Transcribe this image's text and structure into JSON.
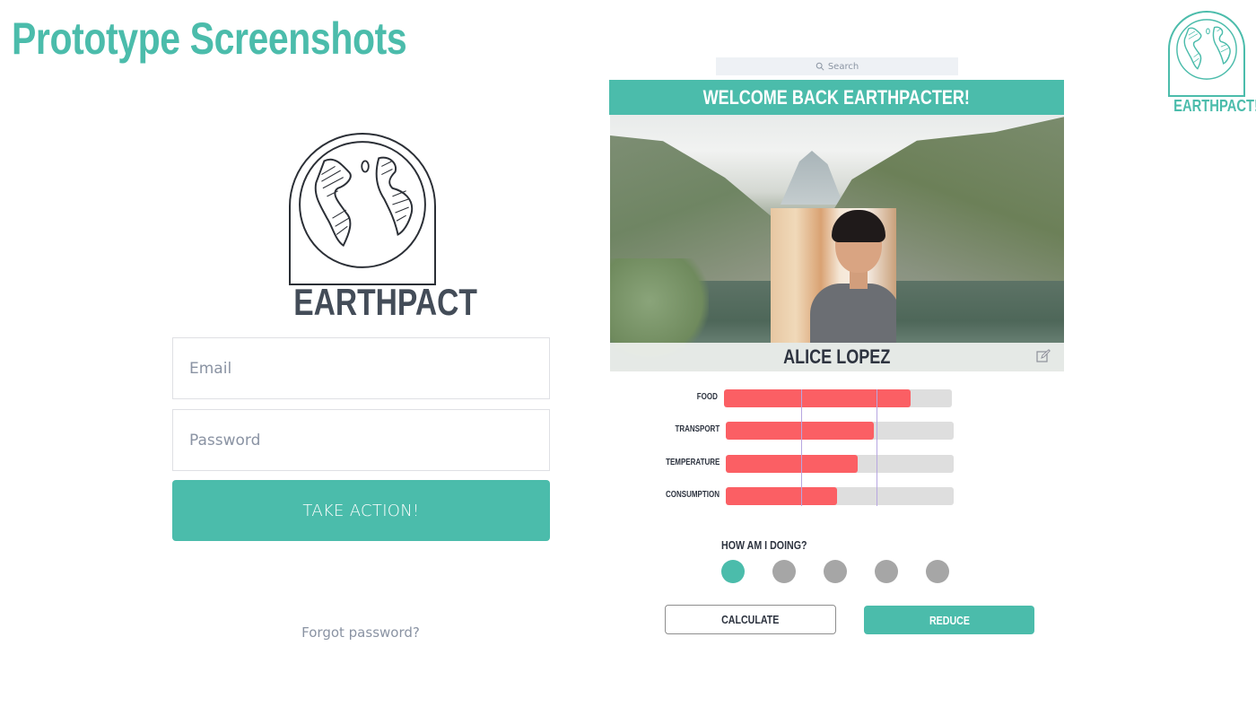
{
  "page": {
    "title": "Prototype Screenshots",
    "brand_logo_text": "EARTHPACT!",
    "colors": {
      "accent": "#4bbcab",
      "bar_fill": "#fb5f64",
      "bar_track": "#dedede",
      "reference_line": "#b7a6e0",
      "dot_inactive": "#a6a6a6",
      "text_dark": "#2e3440"
    }
  },
  "login": {
    "logo_text": "EARTHPACT",
    "email_placeholder": "Email",
    "email_value": "",
    "password_placeholder": "Password",
    "password_value": "",
    "submit_label": "TAKE ACTION!",
    "forgot_label": "Forgot password?"
  },
  "dashboard": {
    "search_placeholder": "Search",
    "search_icon": "search-icon",
    "welcome": "WELCOME BACK EARTHPACTER!",
    "user_name": "ALICE LOPEZ",
    "edit_icon": "edit-icon",
    "metrics": [
      {
        "label": "FOOD",
        "value": 0.82
      },
      {
        "label": "TRANSPORT",
        "value": 0.65
      },
      {
        "label": "TEMPERATURE",
        "value": 0.58
      },
      {
        "label": "CONSUMPTION",
        "value": 0.49
      }
    ],
    "reference_marks": [
      0.34,
      0.67
    ],
    "rating": {
      "label": "HOW AM I DOING?",
      "total": 5,
      "selected": 1
    },
    "calculate_label": "CALCULATE",
    "reduce_label": "REDUCE"
  }
}
